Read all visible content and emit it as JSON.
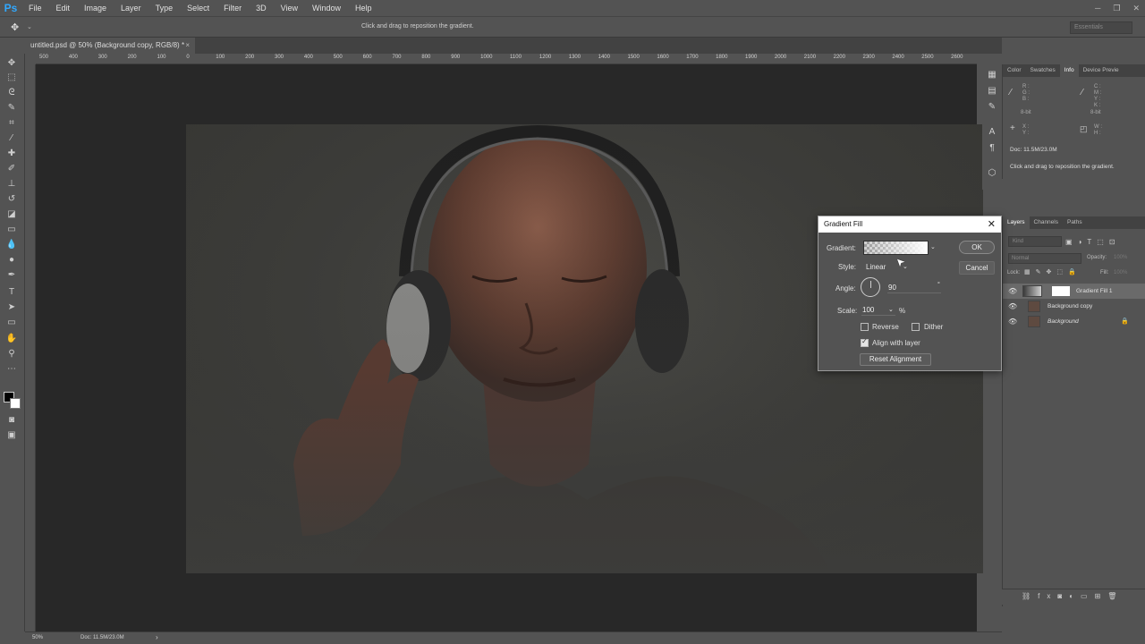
{
  "app": {
    "logo": "Ps"
  },
  "menu": [
    "File",
    "Edit",
    "Image",
    "Layer",
    "Type",
    "Select",
    "Filter",
    "3D",
    "View",
    "Window",
    "Help"
  ],
  "options_bar": {
    "hint": "Click and drag to reposition the gradient.",
    "workspace": "Essentials"
  },
  "document_tab": {
    "title": "untitled.psd @ 50% (Background copy, RGB/8) *",
    "close": "×"
  },
  "ruler_ticks": [
    "500",
    "400",
    "300",
    "200",
    "100",
    "0",
    "100",
    "200",
    "300",
    "400",
    "500",
    "600",
    "700",
    "800",
    "900",
    "1000",
    "1100",
    "1200",
    "1300",
    "1400",
    "1500",
    "1600",
    "1700",
    "1800",
    "1900",
    "2000",
    "2100",
    "2200",
    "2300",
    "2400",
    "2500",
    "2600"
  ],
  "status_bar": {
    "zoom": "50%",
    "doc": "Doc: 11.5M/23.0M"
  },
  "info_panel": {
    "tabs": [
      "Color",
      "Swatches",
      "Info",
      "Device Previe"
    ],
    "active_tab": "Info",
    "rgb_labels": "R :\nG :\nB :",
    "cmyk_labels": "C :\nM :\nY :\nK :",
    "bit_left": "8-bit",
    "bit_right": "8-bit",
    "xy_labels": "X :\nY :",
    "wh_labels": "W :\nH :",
    "doc": "Doc: 11.5M/23.0M",
    "hint": "Click and drag to reposition the gradient."
  },
  "layers_panel": {
    "tabs": [
      "Layers",
      "Channels",
      "Paths"
    ],
    "active_tab": "Layers",
    "filter_placeholder": "Kind",
    "blend_mode": "Normal",
    "opacity_label": "Opacity:",
    "opacity_value": "100%",
    "lock_label": "Lock:",
    "fill_label": "Fill:",
    "fill_value": "100%",
    "layers": [
      {
        "name": "Gradient Fill 1",
        "selected": true
      },
      {
        "name": "Background copy",
        "selected": false
      },
      {
        "name": "Background",
        "selected": false
      }
    ]
  },
  "dialog": {
    "title": "Gradient Fill",
    "gradient_label": "Gradient:",
    "style_label": "Style:",
    "style_value": "Linear",
    "angle_label": "Angle:",
    "angle_value": "90",
    "angle_unit": "°",
    "scale_label": "Scale:",
    "scale_value": "100",
    "scale_unit": "%",
    "reverse_label": "Reverse",
    "reverse_checked": false,
    "dither_label": "Dither",
    "dither_checked": false,
    "align_label": "Align with layer",
    "align_checked": true,
    "reset_label": "Reset Alignment",
    "ok_label": "OK",
    "cancel_label": "Cancel"
  }
}
